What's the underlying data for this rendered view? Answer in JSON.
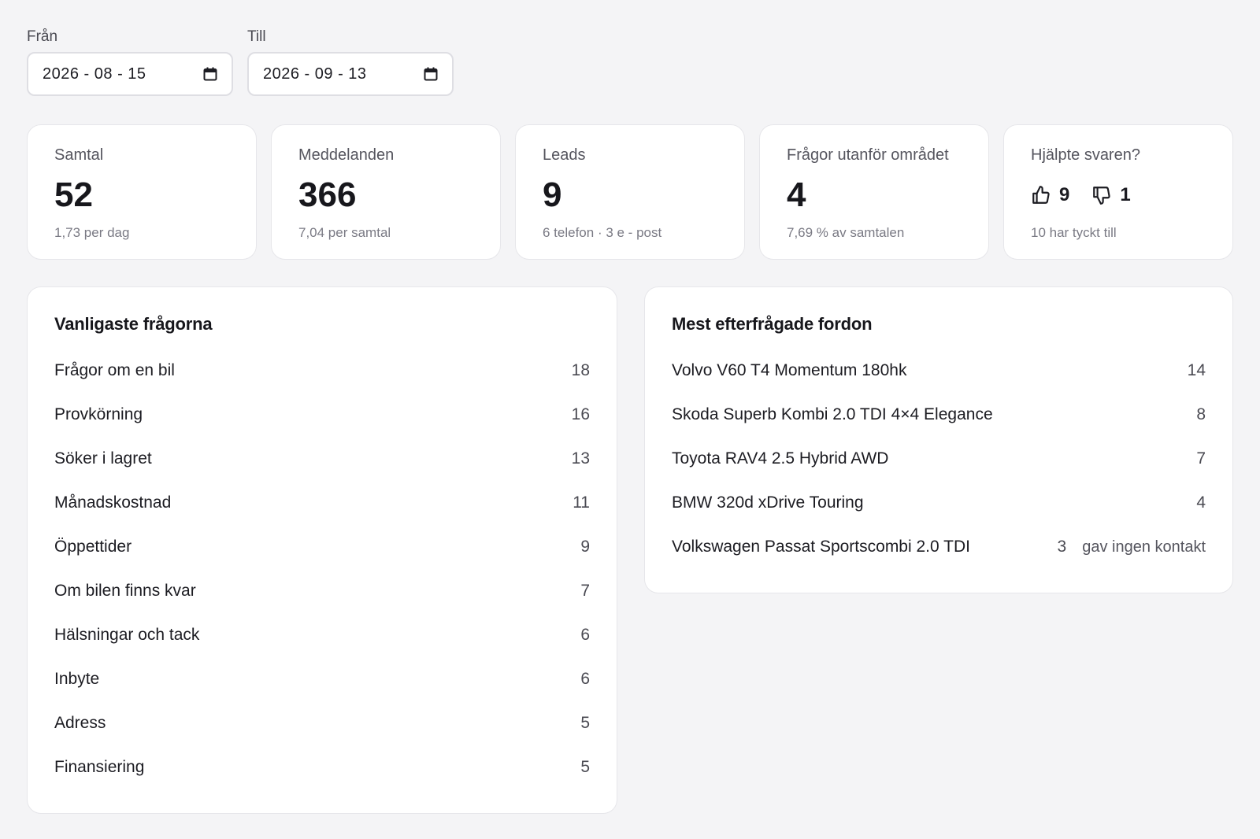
{
  "filters": {
    "from": {
      "label": "Från",
      "value": "2026 - 08 - 15"
    },
    "to": {
      "label": "Till",
      "value": "2026 - 09 - 13"
    }
  },
  "stats": {
    "calls": {
      "label": "Samtal",
      "value": "52",
      "sub": "1,73 per dag"
    },
    "messages": {
      "label": "Meddelanden",
      "value": "366",
      "sub": "7,04 per samtal"
    },
    "leads": {
      "label": "Leads",
      "value": "9",
      "sub": "6 telefon · 3 e - post"
    },
    "out_of_scope": {
      "label": "Frågor utanför området",
      "value": "4",
      "sub": "7,69 % av samtalen"
    },
    "helpful": {
      "label": "Hjälpte svaren?",
      "up": "9",
      "down": "1",
      "sub": "10 har tyckt till"
    }
  },
  "common_questions": {
    "title": "Vanligaste frågorna",
    "items": [
      {
        "label": "Frågor om en bil",
        "count": "18"
      },
      {
        "label": "Provkörning",
        "count": "16"
      },
      {
        "label": "Söker i lagret",
        "count": "13"
      },
      {
        "label": "Månadskostnad",
        "count": "11"
      },
      {
        "label": "Öppettider",
        "count": "9"
      },
      {
        "label": "Om bilen finns kvar",
        "count": "7"
      },
      {
        "label": "Hälsningar och tack",
        "count": "6"
      },
      {
        "label": "Inbyte",
        "count": "6"
      },
      {
        "label": "Adress",
        "count": "5"
      },
      {
        "label": "Finansiering",
        "count": "5"
      }
    ]
  },
  "top_vehicles": {
    "title": "Mest efterfrågade fordon",
    "items": [
      {
        "label": "Volvo V60 T4 Momentum 180hk",
        "count": "14",
        "note": ""
      },
      {
        "label": "Skoda Superb Kombi 2.0 TDI 4×4 Elegance",
        "count": "8",
        "note": ""
      },
      {
        "label": "Toyota RAV4 2.5 Hybrid AWD",
        "count": "7",
        "note": ""
      },
      {
        "label": "BMW 320d xDrive Touring",
        "count": "4",
        "note": ""
      },
      {
        "label": "Volkswagen Passat Sportscombi 2.0 TDI",
        "count": "3",
        "note": "gav ingen kontakt"
      }
    ]
  }
}
